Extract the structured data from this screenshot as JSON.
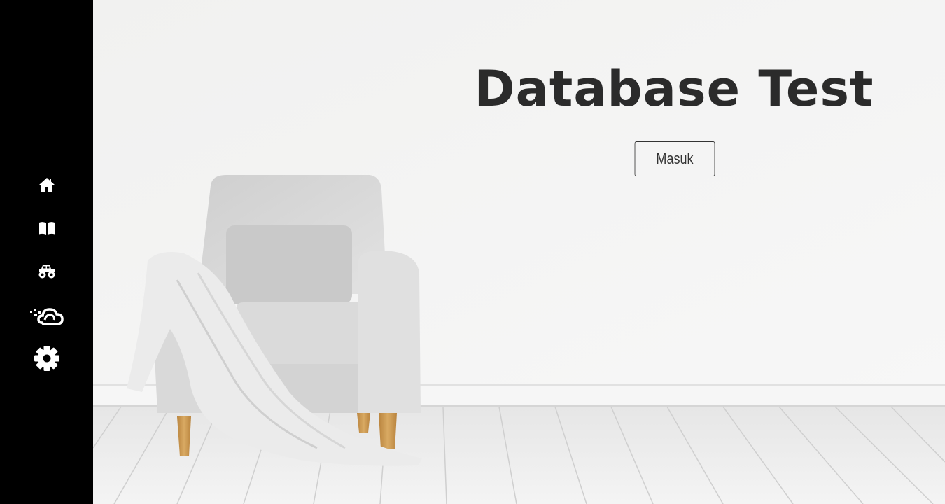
{
  "hero": {
    "title": "Database Test",
    "enter_label": "Masuk"
  },
  "sidebar": {
    "items": [
      {
        "icon": "home-icon"
      },
      {
        "icon": "book-icon"
      },
      {
        "icon": "monster-truck-icon"
      },
      {
        "icon": "cloud-data-icon"
      },
      {
        "icon": "gear-icon"
      }
    ]
  },
  "colors": {
    "sidebar": "#000000",
    "icon": "#ffffff",
    "wall": "#f3f3f3",
    "floor": "#ededed",
    "title": "#2b2b2b",
    "chair": "#d6d6d6",
    "legs": "#c8974f"
  }
}
